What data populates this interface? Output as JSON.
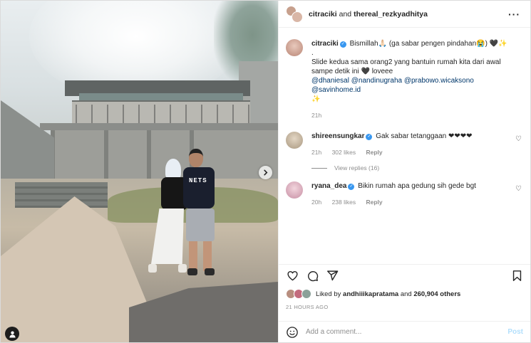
{
  "header": {
    "user1": "citraciki",
    "and_text": "and",
    "user2": "thereal_rezkyadhitya",
    "more_icon": "more-horizontal-icon"
  },
  "photo": {
    "shirt_text": "NETS",
    "next_icon": "chevron-right-icon",
    "tag_icon": "user-tag-icon"
  },
  "caption": {
    "username": "citraciki",
    "line1": "Bismillah🙏🏻 (ga sabar pengen pindahan😭) 🖤✨",
    "line2": ".",
    "line3": "Slide kedua sama orang2 yang bantuin rumah kita dari awal sampe detik ini 🖤 loveee",
    "mentions": "@dhaniesal @nandinugraha @prabowo.wicaksono @savinhome.id",
    "line4": "✨",
    "time": "21h"
  },
  "comments": [
    {
      "username": "shireensungkar",
      "text": "Gak sabar tetanggaan ❤❤❤❤",
      "time": "21h",
      "likes": "302 likes",
      "reply": "Reply",
      "view_replies": "View replies (16)"
    },
    {
      "username": "ryana_dea",
      "text": "Bikin rumah apa gedung sih gede bgt",
      "time": "20h",
      "likes": "238 likes",
      "reply": "Reply"
    }
  ],
  "likes": {
    "prefix": "Liked by",
    "user": "andhiiikapratama",
    "mid": "and",
    "count": "260,904 others"
  },
  "timeago": "21 HOURS AGO",
  "comment_box": {
    "placeholder": "Add a comment...",
    "post_label": "Post"
  },
  "colors": {
    "verified": "#3897f0",
    "post_disabled": "#b2dffc",
    "mention": "#00376b"
  }
}
